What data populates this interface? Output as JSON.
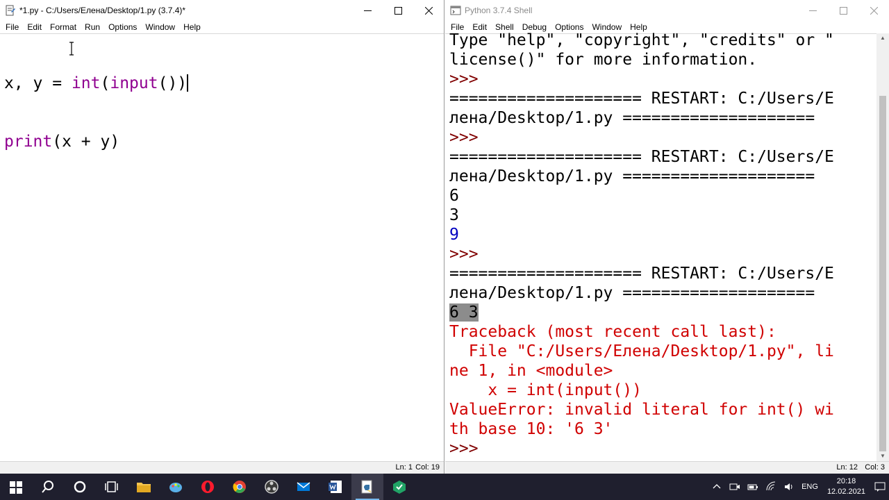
{
  "editor": {
    "title": "*1.py - C:/Users/Елена/Desktop/1.py (3.7.4)*",
    "menu": [
      "File",
      "Edit",
      "Format",
      "Run",
      "Options",
      "Window",
      "Help"
    ],
    "code_line1_pre": "x, y = ",
    "code_line1_int": "int",
    "code_line1_mid": "(",
    "code_line1_input": "input",
    "code_line1_post": "())",
    "code_line2_print": "print",
    "code_line2_post": "(x + y)",
    "status_ln": "Ln: 1",
    "status_col": "Col: 19"
  },
  "shell": {
    "title": "Python 3.7.4 Shell",
    "menu": [
      "File",
      "Edit",
      "Shell",
      "Debug",
      "Options",
      "Window",
      "Help"
    ],
    "lines": [
      {
        "text": "Type \"help\", \"copyright\", \"credits\" or \"",
        "kind": "plain"
      },
      {
        "text": "license()\" for more information.",
        "kind": "plain"
      },
      {
        "text": ">>> ",
        "kind": "prompt"
      },
      {
        "text": "==================== RESTART: C:/Users/E",
        "kind": "plain"
      },
      {
        "text": "лена/Desktop/1.py ====================",
        "kind": "plain"
      },
      {
        "text": ">>> ",
        "kind": "prompt"
      },
      {
        "text": "==================== RESTART: C:/Users/E",
        "kind": "plain"
      },
      {
        "text": "лена/Desktop/1.py ====================",
        "kind": "plain"
      },
      {
        "text": "6",
        "kind": "plain"
      },
      {
        "text": "3",
        "kind": "plain"
      },
      {
        "text": "9",
        "kind": "out"
      },
      {
        "text": ">>> ",
        "kind": "prompt"
      },
      {
        "text": "==================== RESTART: C:/Users/E",
        "kind": "plain"
      },
      {
        "text": "лена/Desktop/1.py ====================",
        "kind": "plain"
      },
      {
        "text": "6 3",
        "kind": "sel"
      },
      {
        "text": "Traceback (most recent call last):",
        "kind": "err"
      },
      {
        "text": "  File \"C:/Users/Елена/Desktop/1.py\", li",
        "kind": "err"
      },
      {
        "text": "ne 1, in <module>",
        "kind": "err"
      },
      {
        "text": "    x = int(input())",
        "kind": "err"
      },
      {
        "text": "ValueError: invalid literal for int() wi",
        "kind": "err"
      },
      {
        "text": "th base 10: '6 3'",
        "kind": "err"
      },
      {
        "text": ">>> ",
        "kind": "prompt"
      }
    ],
    "status_ln": "Ln: 12",
    "status_col": "Col: 3"
  },
  "taskbar": {
    "items": [
      {
        "name": "start-button",
        "icon": "windows-logo-icon",
        "color": "#ffffff"
      },
      {
        "name": "search-button",
        "icon": "search-icon",
        "color": "#ffffff"
      },
      {
        "name": "cortana-button",
        "icon": "cortana-circle-icon",
        "color": "#ffffff"
      },
      {
        "name": "task-view-button",
        "icon": "task-view-icon",
        "color": "#ffffff"
      },
      {
        "name": "file-explorer-button",
        "icon": "folder-icon",
        "color": "#f4c44e"
      },
      {
        "name": "paint-button",
        "icon": "paint-icon",
        "color": "#5ab0e8"
      },
      {
        "name": "opera-button",
        "icon": "opera-icon",
        "color": "#ff1b2d"
      },
      {
        "name": "chrome-button",
        "icon": "chrome-icon",
        "color": "#e34133"
      },
      {
        "name": "obs-button",
        "icon": "obs-icon",
        "color": "#d0d0d0"
      },
      {
        "name": "mail-button",
        "icon": "mail-icon",
        "color": "#0078d7"
      },
      {
        "name": "word-button",
        "icon": "word-icon",
        "color": "#2b579a"
      },
      {
        "name": "python-idle-button",
        "icon": "python-idle-icon",
        "color": "#f0d050"
      },
      {
        "name": "green-app-button",
        "icon": "green-cube-icon",
        "color": "#21a366"
      }
    ],
    "language": "ENG",
    "time": "20:18",
    "date": "12.02.2021"
  }
}
